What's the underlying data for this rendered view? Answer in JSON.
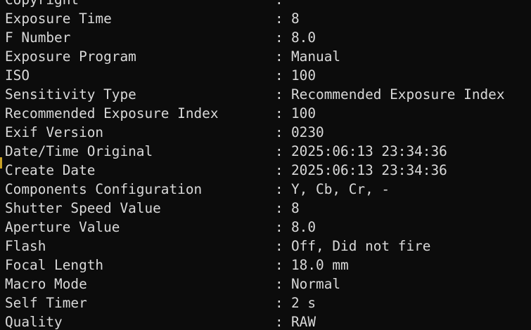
{
  "terminal": {
    "rows": [
      {
        "key": "Copyright",
        "sep": ":",
        "value": ""
      },
      {
        "key": "Exposure Time",
        "sep": ":",
        "value": "8"
      },
      {
        "key": "F Number",
        "sep": ":",
        "value": "8.0"
      },
      {
        "key": "Exposure Program",
        "sep": ":",
        "value": "Manual"
      },
      {
        "key": "ISO",
        "sep": ":",
        "value": "100"
      },
      {
        "key": "Sensitivity Type",
        "sep": ":",
        "value": "Recommended Exposure Index"
      },
      {
        "key": "Recommended Exposure Index",
        "sep": ":",
        "value": "100"
      },
      {
        "key": "Exif Version",
        "sep": ":",
        "value": "0230"
      },
      {
        "key": "Date/Time Original",
        "sep": ":",
        "value": "2025:06:13 23:34:36"
      },
      {
        "key": "Create Date",
        "sep": ":",
        "value": "2025:06:13 23:34:36"
      },
      {
        "key": "Components Configuration",
        "sep": ":",
        "value": "Y, Cb, Cr, -"
      },
      {
        "key": "Shutter Speed Value",
        "sep": ":",
        "value": "8"
      },
      {
        "key": "Aperture Value",
        "sep": ":",
        "value": "8.0"
      },
      {
        "key": "Flash",
        "sep": ":",
        "value": "Off, Did not fire"
      },
      {
        "key": "Focal Length",
        "sep": ":",
        "value": "18.0 mm"
      },
      {
        "key": "Macro Mode",
        "sep": ":",
        "value": "Normal"
      },
      {
        "key": "Self Timer",
        "sep": ":",
        "value": "2 s"
      },
      {
        "key": "Quality",
        "sep": ":",
        "value": "RAW"
      }
    ]
  },
  "colors": {
    "background": "#0c0c0c",
    "text": "#d9d9d9",
    "gutter_marker": "#c9a227"
  }
}
